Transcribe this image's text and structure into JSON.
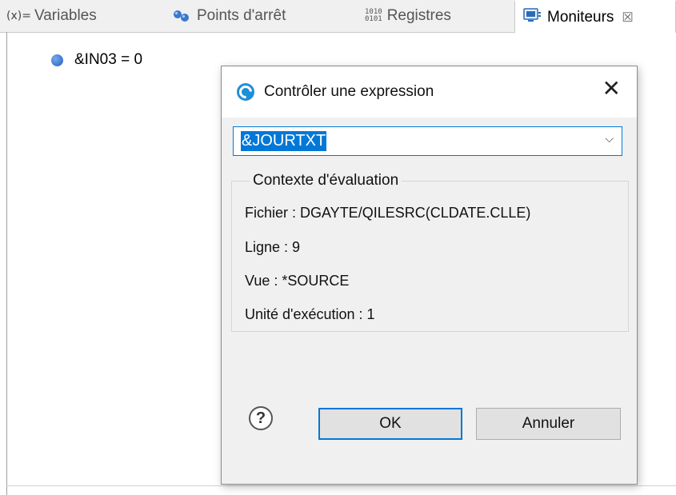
{
  "tabs": [
    {
      "icon": "variables-icon",
      "icon_glyph": "(x)=",
      "label": "Variables"
    },
    {
      "icon": "breakpoints-icon",
      "label": "Points d'arrêt"
    },
    {
      "icon": "registers-icon",
      "icon_glyph_top": "1010",
      "icon_glyph_bottom": "0101",
      "label": "Registres"
    },
    {
      "icon": "monitors-icon",
      "label": "Moniteurs",
      "close_glyph": "☒"
    }
  ],
  "tree": {
    "items": [
      {
        "icon": "monitor-dot-icon",
        "label": "&IN03 = 0"
      }
    ]
  },
  "dialog": {
    "title": "Contrôler une expression",
    "close_glyph": "✕",
    "expression_value": "&JOURTXT",
    "chevron_glyph": "⌵",
    "context": {
      "legend": "Contexte d'évaluation",
      "file": "Fichier : DGAYTE/QILESRC(CLDATE.CLLE)",
      "line": "Ligne : 9",
      "view": "Vue : *SOURCE",
      "thread": "Unité d'exécution : 1"
    },
    "help_glyph": "?",
    "ok_label": "OK",
    "cancel_label": "Annuler"
  },
  "colors": {
    "accent": "#0078d7",
    "dialog_body": "#f0f0f0",
    "tab_bar": "#f0f0f0"
  }
}
